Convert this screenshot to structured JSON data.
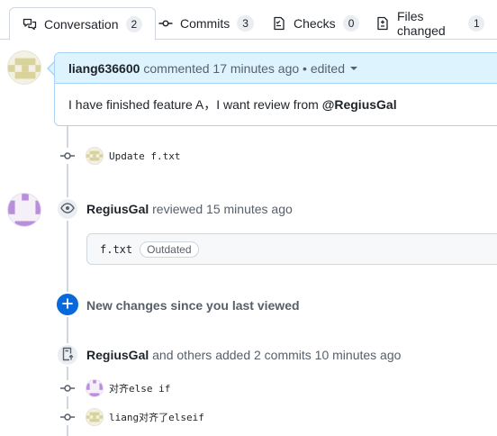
{
  "tabs": [
    {
      "label": "Conversation",
      "count": "2",
      "icon": "comment-discussion-icon"
    },
    {
      "label": "Commits",
      "count": "3",
      "icon": "git-commit-icon"
    },
    {
      "label": "Checks",
      "count": "0",
      "icon": "checklist-icon"
    },
    {
      "label": "Files changed",
      "count": "1",
      "icon": "file-diff-icon"
    }
  ],
  "comment": {
    "author": "liang636600",
    "meta": "commented 17 minutes ago • edited",
    "body_prefix": "I have finished feature A，I want review from ",
    "mention": "@RegiusGal"
  },
  "commits": [
    {
      "message": "Update f.txt",
      "avatar": "liang"
    },
    {
      "message": "对齐else if",
      "avatar": "regius"
    },
    {
      "message": "liang对齐了elseif",
      "avatar": "liang"
    }
  ],
  "review": {
    "author": "RegiusGal",
    "text": "reviewed 15 minutes ago",
    "file": "f.txt",
    "status": "Outdated"
  },
  "new_changes": "New changes since you last viewed",
  "commits_event": {
    "author": "RegiusGal",
    "text": "and others added 2 commits 10 minutes ago"
  },
  "colors": {
    "accent_blue": "#0969da",
    "header_bg": "#ddf4ff",
    "border": "#d0d7de"
  }
}
